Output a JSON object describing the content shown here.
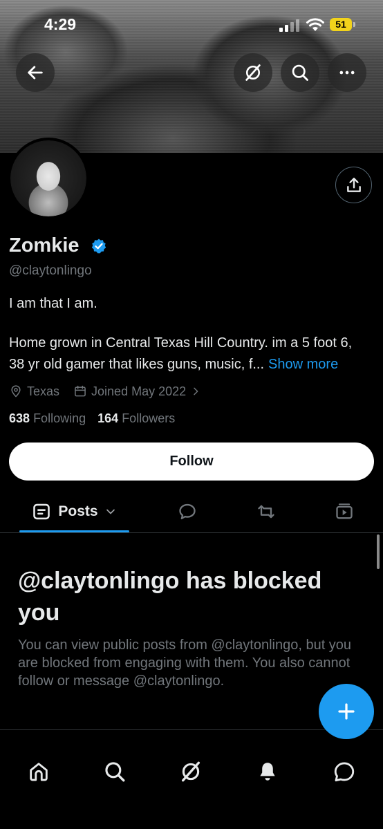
{
  "status_bar": {
    "time": "4:29",
    "battery": "51"
  },
  "profile": {
    "display_name": "Zomkie",
    "handle": "@claytonlingo",
    "bio_line1": "I am that I am.",
    "bio_line2": "Home grown in Central Texas Hill Country. im a 5 foot 6,",
    "bio_line3": "38 yr old gamer that likes guns, music, f...",
    "show_more": "Show more",
    "location": "Texas",
    "joined": "Joined May 2022",
    "following_count": "638",
    "following_label": "Following",
    "followers_count": "164",
    "followers_label": "Followers"
  },
  "follow_button": "Follow",
  "tabs": {
    "posts_label": "Posts"
  },
  "blocked": {
    "title": "@claytonlingo has blocked you",
    "body": "You can view public posts from @claytonlingo, but you are blocked from engaging with them. You also cannot follow or message @claytonlingo."
  },
  "colors": {
    "accent": "#1d9bf0",
    "secondary_text": "#71767b",
    "background": "#000000",
    "battery": "#f2d31b"
  },
  "icons": {
    "back": "arrow-left-icon",
    "grok": "grok-icon",
    "search": "search-icon",
    "more": "more-icon",
    "share": "share-icon",
    "verified": "verified-badge-icon",
    "location": "location-pin-icon",
    "calendar": "calendar-icon",
    "compose": "plus-icon",
    "home": "home-icon",
    "notifications": "bell-icon",
    "messages": "message-icon"
  }
}
